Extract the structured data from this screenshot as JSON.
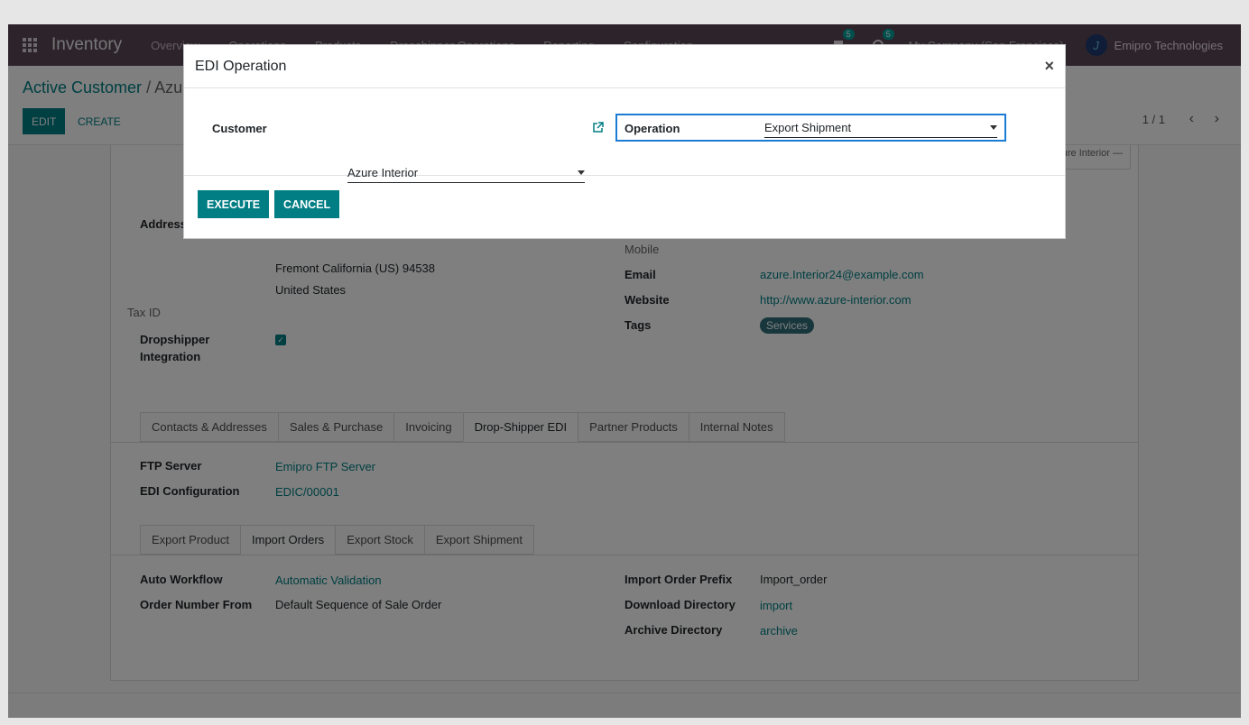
{
  "navbar": {
    "app_name": "Inventory",
    "menu": [
      "Overview",
      "Operations",
      "Products",
      "Dropshipper Operations",
      "Reporting",
      "Configuration"
    ],
    "messages_count": "5",
    "activities_count": "5",
    "company": "My Company (San Francisco)",
    "user": "Emipro Technologies"
  },
  "control_panel": {
    "breadcrumb_parent": "Active Customer",
    "breadcrumb_separator": "/",
    "breadcrumb_current": "Azure Interior",
    "edit_label": "EDIT",
    "create_label": "CREATE",
    "pager": "1 / 1"
  },
  "form": {
    "kanban_hint": "Azure Interior —",
    "address_label": "Address",
    "address_line1": "Fremont  California (US)  94538",
    "address_line2": "United States",
    "tax_id_label": "Tax ID",
    "dropshipper_label_1": "Dropshipper",
    "dropshipper_label_2": "Integration",
    "dropshipper_checked": true,
    "mobile_label": "Mobile",
    "email_label": "Email",
    "email_value": "azure.Interior24@example.com",
    "website_label": "Website",
    "website_value": "http://www.azure-interior.com",
    "tags_label": "Tags",
    "tag_value": "Services"
  },
  "tabs": [
    "Contacts & Addresses",
    "Sales & Purchase",
    "Invoicing",
    "Drop-Shipper EDI",
    "Partner Products",
    "Internal Notes"
  ],
  "active_tab": "Drop-Shipper EDI",
  "edi": {
    "ftp_label": "FTP Server",
    "ftp_value": "Emipro FTP Server",
    "config_label": "EDI Configuration",
    "config_value": "EDIC/00001"
  },
  "subtabs": [
    "Export Product",
    "Import Orders",
    "Export Stock",
    "Export Shipment"
  ],
  "active_subtab": "Import Orders",
  "import_orders": {
    "auto_workflow_label": "Auto Workflow",
    "auto_workflow_value": "Automatic Validation",
    "order_number_label": "Order Number From",
    "order_number_value": "Default Sequence of Sale Order",
    "prefix_label": "Import Order Prefix",
    "prefix_value": "Import_order",
    "download_label": "Download Directory",
    "download_value": "import",
    "archive_label": "Archive Directory",
    "archive_value": "archive"
  },
  "modal": {
    "title": "EDI Operation",
    "close": "×",
    "customer_label": "Customer",
    "customer_value": "Azure Interior",
    "operation_label": "Operation",
    "operation_value": "Export Shipment",
    "execute_label": "EXECUTE",
    "cancel_label": "CANCEL"
  },
  "colors": {
    "navbar": "#5a4856",
    "primary": "#017e84",
    "focus": "#1c7cd5"
  }
}
